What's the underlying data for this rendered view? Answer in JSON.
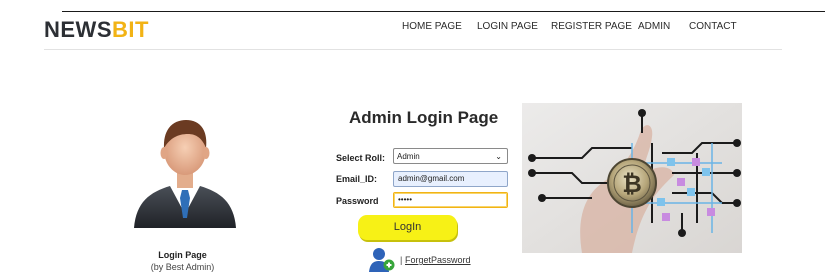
{
  "brand": {
    "part1": "NEWS",
    "part2": "BIT"
  },
  "nav": {
    "items": [
      {
        "label": "HOME PAGE"
      },
      {
        "label": "LOGIN PAGE"
      },
      {
        "label": "REGISTER PAGE"
      },
      {
        "label": "ADMIN"
      },
      {
        "label": "CONTACT"
      }
    ]
  },
  "left": {
    "avatar_icon": "businessman-avatar-icon",
    "caption_title": "Login Page",
    "caption_sub": "(by Best Admin)"
  },
  "form": {
    "title": "Admin Login Page",
    "roll_label": "Select Roll:",
    "roll_value": "Admin",
    "email_label": "Email_ID:",
    "email_value": "admin@gmail.com",
    "password_label": "Password",
    "password_value": "•••••",
    "login_label": "LogIn",
    "separator": "|",
    "forget_label": "ForgetPassword"
  },
  "colors": {
    "brand_dark": "#2c2f34",
    "brand_accent": "#f2b315",
    "button_yellow": "#f7f116"
  }
}
